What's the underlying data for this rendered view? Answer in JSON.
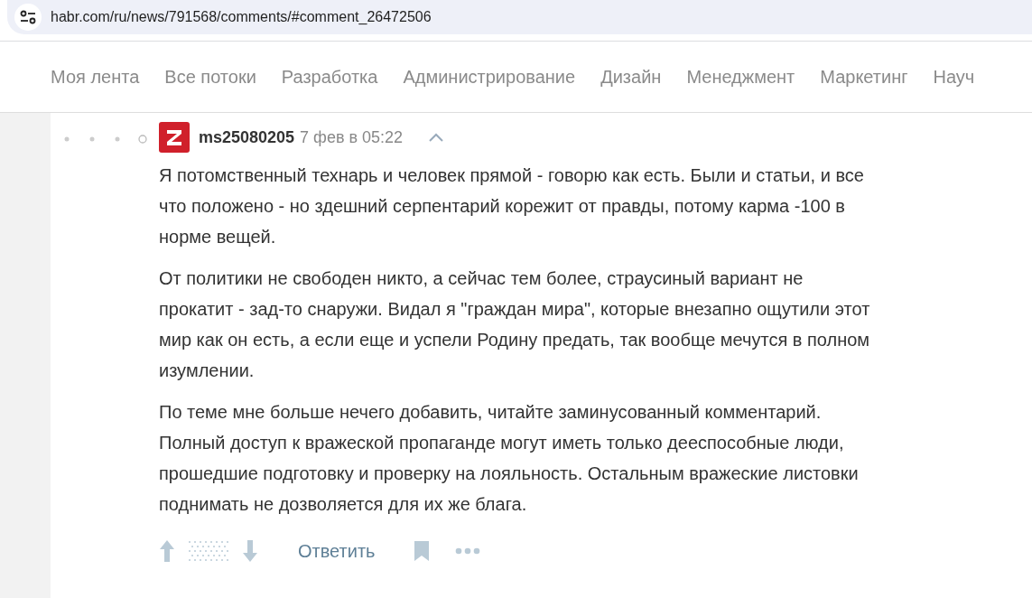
{
  "address_bar": {
    "url": "habr.com/ru/news/791568/comments/#comment_26472506"
  },
  "nav": {
    "items": [
      {
        "label": "Моя лента"
      },
      {
        "label": "Все потоки"
      },
      {
        "label": "Разработка"
      },
      {
        "label": "Администрирование"
      },
      {
        "label": "Дизайн"
      },
      {
        "label": "Менеджмент"
      },
      {
        "label": "Маркетинг"
      },
      {
        "label": "Науч"
      }
    ]
  },
  "comment": {
    "author": "ms25080205",
    "time": "7 фев в 05:22",
    "paragraphs": [
      [
        "Я потомственный технарь и человек прямой - говорю как есть. Были и статьи, и все",
        "что положено - но здешний серпентарий корежит от правды, потому карма -100 в",
        "норме вещей."
      ],
      [
        "От политики не свободен никто, а сейчас тем более, страусиный вариант не",
        "прокатит - зад-то снаружи. Видал я \"граждан мира\", которые внезапно ощутили этот",
        "мир как он есть, а если еще и успели Родину предать, так вообще мечутся в полном",
        "изумлении."
      ],
      [
        "По теме мне больше нечего добавить, читайте заминусованный комментарий.",
        "Полный доступ к вражеской пропаганде могут иметь только дееспособные люди,",
        "прошедшие подготовку и проверку на лояльность. Остальным вражеские листовки",
        "поднимать не дозволяется для их же блага."
      ]
    ],
    "reply": "Ответить"
  }
}
